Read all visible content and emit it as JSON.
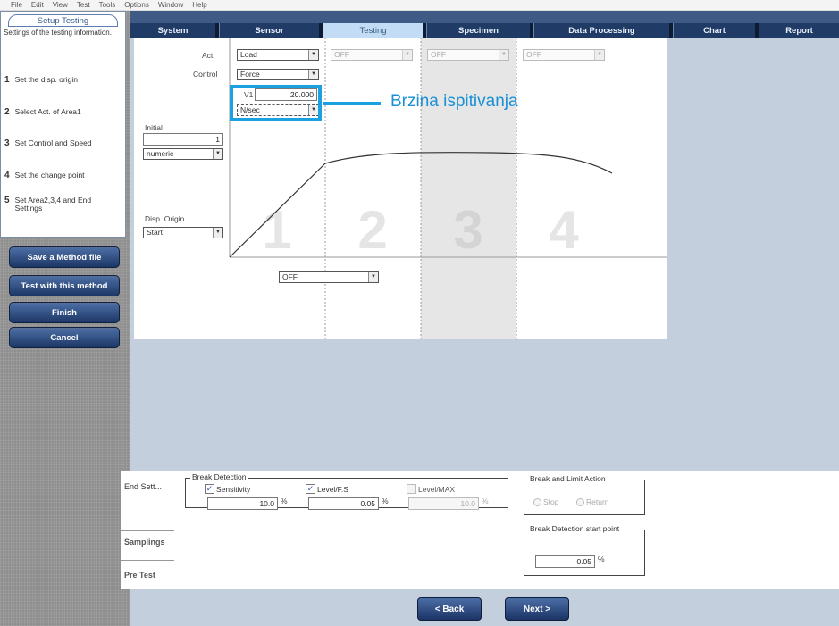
{
  "menu": [
    "File",
    "Edit",
    "View",
    "Test",
    "Tools",
    "Options",
    "Window",
    "Help"
  ],
  "tabs": [
    {
      "label": "System",
      "active": false
    },
    {
      "label": "Sensor",
      "active": false
    },
    {
      "label": "Testing",
      "active": true
    },
    {
      "label": "Specimen",
      "active": false
    },
    {
      "label": "Data Processing",
      "active": false
    },
    {
      "label": "Chart",
      "active": false
    },
    {
      "label": "Report",
      "active": false
    }
  ],
  "sidebar": {
    "header": "Setup Testing",
    "description": "Settings of the testing information.",
    "steps": [
      {
        "num": "1",
        "label": "Set the disp. origin"
      },
      {
        "num": "2",
        "label": "Select Act. of Area1"
      },
      {
        "num": "3",
        "label": "Set Control and Speed"
      },
      {
        "num": "4",
        "label": "Set the change point"
      },
      {
        "num": "5",
        "label": "Set Area2,3,4 and End Settings"
      }
    ],
    "buttons": [
      "Save a Method file",
      "Test with this method",
      "Finish",
      "Cancel"
    ]
  },
  "chart_setup": {
    "act_label": "Act",
    "act_value": "Load",
    "act_area2": "OFF",
    "act_area3": "OFF",
    "act_area4": "OFF",
    "control_label": "Control",
    "control_value": "Force",
    "speed_label": "V1",
    "speed_value": "20.000",
    "speed_unit": "N/sec",
    "initial_label": "Initial",
    "initial_value": "1",
    "initial_select": "numeric",
    "disp_origin_label": "Disp. Origin",
    "disp_origin_value": "Start",
    "change_point_value": "OFF",
    "area_numbers": [
      "1",
      "2",
      "3",
      "4"
    ]
  },
  "annotation": {
    "text": "Brzina ispitivanja",
    "color": "#1ba1e0"
  },
  "settings": {
    "tabs": [
      "End Sett...",
      "Samplings",
      "Pre Test"
    ],
    "break_detection": {
      "title": "Break Detection",
      "sensitivity_label": "Sensitivity",
      "sensitivity_value": "10.0",
      "level_fs_label": "Level/F.S",
      "level_fs_value": "0.05",
      "level_max_label": "Level/MAX",
      "level_max_value": "10.0",
      "unit": "%"
    },
    "break_limit_action": {
      "title": "Break and Limit Action",
      "opt_stop": "Stop",
      "opt_return": "Return"
    },
    "break_start": {
      "title": "Break Detection start point",
      "value": "0.05",
      "unit": "%"
    }
  },
  "footer": {
    "back": "< Back",
    "next": "Next >"
  }
}
